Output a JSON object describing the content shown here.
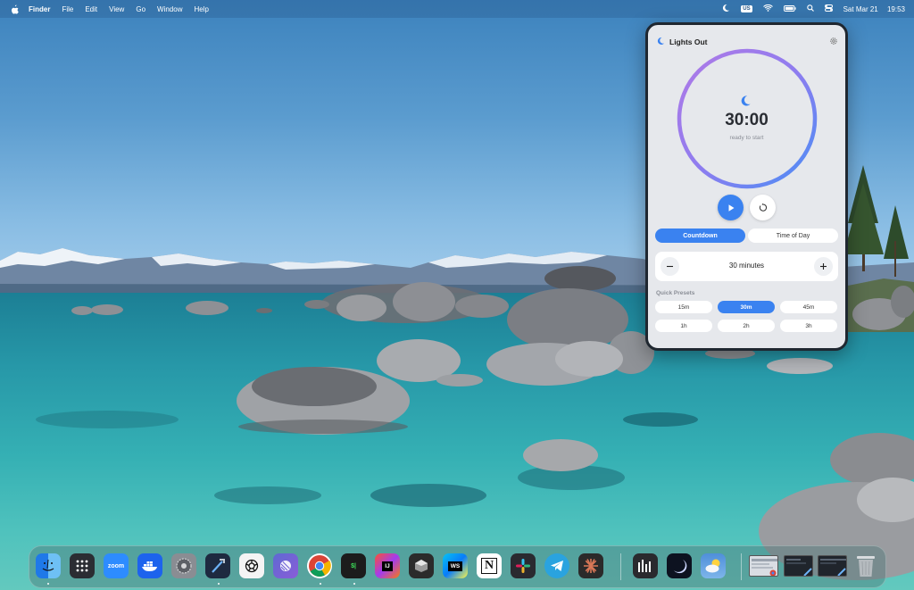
{
  "menubar": {
    "app_name": "Finder",
    "menus": [
      "File",
      "Edit",
      "View",
      "Go",
      "Window",
      "Help"
    ],
    "keyboard_badge": "US",
    "date": "Sat Mar 21",
    "time": "19:53",
    "status_icons": [
      "lights-out-moon-icon",
      "keyboard-input-icon",
      "wifi-icon",
      "battery-icon",
      "search-icon",
      "control-center-icon"
    ]
  },
  "popover": {
    "title": "Lights Out",
    "timer_value": "30:00",
    "status": "ready to start",
    "mode_tabs": [
      "Countdown",
      "Time of Day"
    ],
    "active_tab": "Countdown",
    "duration_value": "30 minutes",
    "quick_presets_label": "Quick Presets",
    "presets": [
      "15m",
      "30m",
      "45m",
      "1h",
      "2h",
      "3h"
    ],
    "selected_preset": "30m",
    "colors": {
      "accent": "#3a82f0",
      "ring_start": "#a77be8",
      "ring_end": "#4a8ef5",
      "panel": "#e6e8ec"
    }
  },
  "dock": {
    "zoom_label": "zoom",
    "terminal_label": "$|",
    "intellij_label": "IJ",
    "webstorm_label": "WS",
    "notion_label": "N",
    "apps": [
      {
        "name": "Finder",
        "icon": "finder-icon",
        "running": true
      },
      {
        "name": "Launchpad",
        "icon": "launchpad-icon",
        "running": false
      },
      {
        "name": "Zoom",
        "icon": "zoom-icon",
        "running": false
      },
      {
        "name": "Docker",
        "icon": "docker-icon",
        "running": false
      },
      {
        "name": "System Settings",
        "icon": "settings-icon",
        "running": false
      },
      {
        "name": "Xcode",
        "icon": "xcode-icon",
        "running": true
      },
      {
        "name": "ChatGPT",
        "icon": "chatgpt-icon",
        "running": false
      },
      {
        "name": "Linear",
        "icon": "linear-icon",
        "running": false
      },
      {
        "name": "Chrome",
        "icon": "chrome-icon",
        "running": true
      },
      {
        "name": "Terminal",
        "icon": "terminal-icon",
        "running": true
      },
      {
        "name": "IntelliJ IDEA",
        "icon": "intellij-icon",
        "running": false
      },
      {
        "name": "Cursor",
        "icon": "cursor-icon",
        "running": false
      },
      {
        "name": "WebStorm",
        "icon": "webstorm-icon",
        "running": false
      },
      {
        "name": "Notion",
        "icon": "notion-icon",
        "running": false
      },
      {
        "name": "Slack",
        "icon": "slack-icon",
        "running": false
      },
      {
        "name": "Telegram",
        "icon": "telegram-icon",
        "running": false
      },
      {
        "name": "Claude",
        "icon": "claude-icon",
        "running": false
      },
      {
        "name": "Audio Meter",
        "icon": "audio-bars-icon",
        "running": false
      },
      {
        "name": "Lights Out",
        "icon": "lights-out-moon-icon",
        "running": false
      },
      {
        "name": "Weather",
        "icon": "weather-icon",
        "running": false
      }
    ],
    "trash_icon": "trash-icon"
  }
}
